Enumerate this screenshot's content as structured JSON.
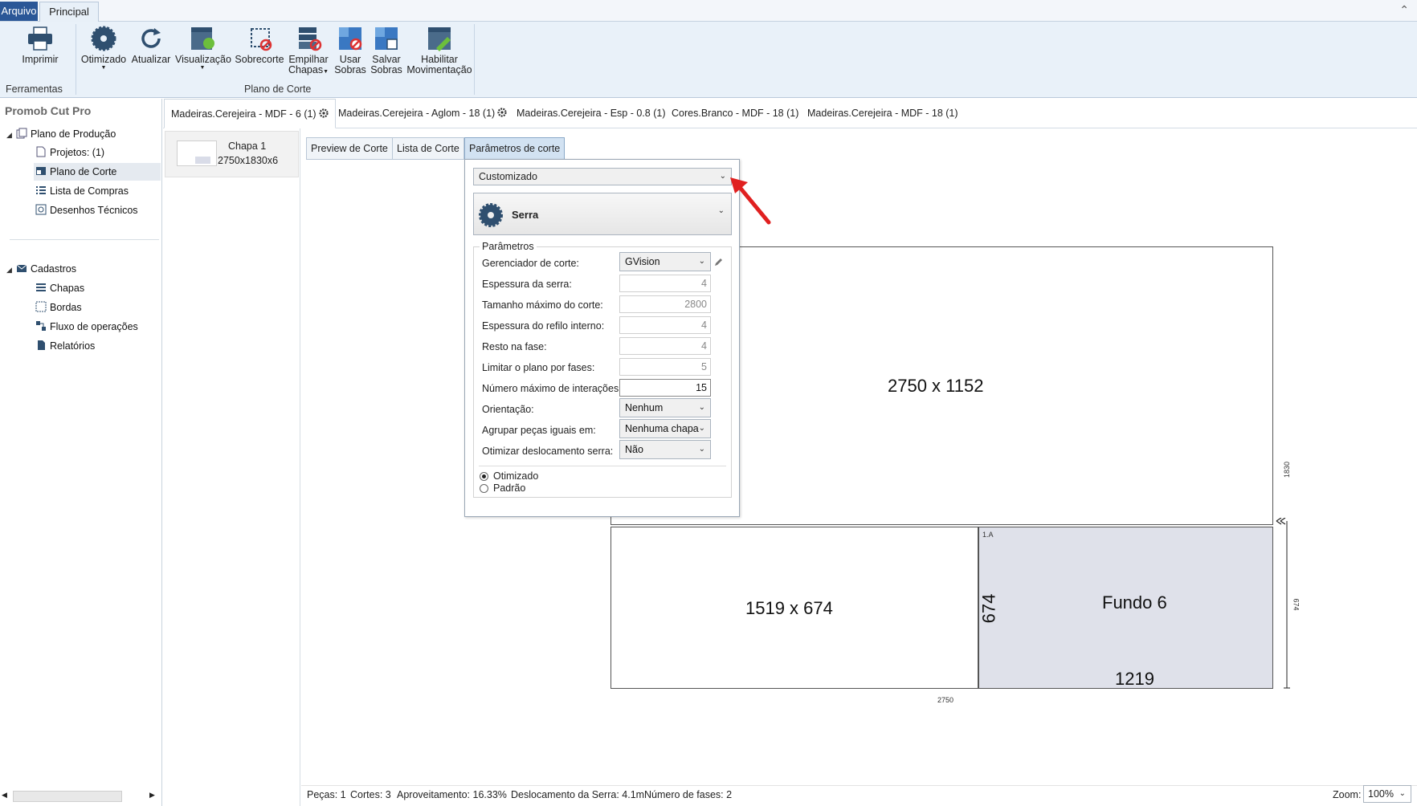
{
  "ribbon_tabs": {
    "file": "Arquivo",
    "home": "Principal"
  },
  "ribbon": {
    "print": "Imprimir",
    "optimized": "Otimizado",
    "refresh": "Atualizar",
    "view": "Visualização",
    "overcut": "Sobrecorte",
    "stack_l1": "Empilhar",
    "stack_l2": "Chapas",
    "use_leftovers_l1": "Usar",
    "use_leftovers_l2": "Sobras",
    "save_leftovers_l1": "Salvar",
    "save_leftovers_l2": "Sobras",
    "enable_l1": "Habilitar",
    "enable_l2": "Movimentação",
    "group_tools": "Ferramentas",
    "group_plan": "Plano de Corte"
  },
  "sidebar": {
    "title": "Promob Cut Pro",
    "production_plan": "Plano de Produção",
    "projects": "Projetos: (1)",
    "cut_plan": "Plano de Corte",
    "shopping_list": "Lista de Compras",
    "technical_drawings": "Desenhos Técnicos",
    "registers": "Cadastros",
    "sheets": "Chapas",
    "edges": "Bordas",
    "operations_flow": "Fluxo de operações",
    "reports": "Relatórios"
  },
  "material_tabs": [
    "Madeiras.Cerejeira - MDF - 6 (1)",
    "Madeiras.Cerejeira - Aglom - 18 (1)",
    "Madeiras.Cerejeira - Esp - 0.8 (1)",
    "Cores.Branco - MDF - 18 (1)",
    "Madeiras.Cerejeira - MDF - 18 (1)"
  ],
  "chapa": {
    "name": "Chapa 1",
    "size": "2750x1830x6"
  },
  "view_buttons": {
    "preview": "Preview de Corte",
    "list": "Lista de Corte",
    "params": "Parâmetros de corte"
  },
  "drawing": {
    "top_area": "2750 x 1152",
    "bottom_left": "1519 x 674",
    "piece_name": "Fundo 6",
    "piece_id": "1.A",
    "piece_height": "674",
    "piece_width": "1219",
    "dim_total_h": "1830",
    "dim_piece_h": "674",
    "dim_total_w": "2750"
  },
  "params": {
    "preset": "Customizado",
    "tool": "Serra",
    "legend": "Parâmetros",
    "fields": [
      {
        "label": "Gerenciador de corte:",
        "value": "GVision"
      },
      {
        "label": "Espessura da serra:",
        "value": "4"
      },
      {
        "label": "Tamanho máximo do corte:",
        "value": "2800"
      },
      {
        "label": "Espessura do refilo interno:",
        "value": "4"
      },
      {
        "label": "Resto na fase:",
        "value": "4"
      },
      {
        "label": "Limitar o plano por fases:",
        "value": "5"
      },
      {
        "label": "Número máximo de interações:",
        "value": "15"
      },
      {
        "label": "Orientação:",
        "value": "Nenhum"
      },
      {
        "label": "Agrupar peças iguais em:",
        "value": "Nenhuma chapa"
      },
      {
        "label": "Otimizar deslocamento serra:",
        "value": "Não"
      }
    ],
    "mode_optimized": "Otimizado",
    "mode_default": "Padrão"
  },
  "status": {
    "pieces": "Peças: 1",
    "cuts": "Cortes: 3",
    "usage": "Aproveitamento: 16.33%",
    "saw_travel": "Deslocamento da Serra: 4.1m",
    "phases": "Número de fases: 2",
    "zoom_label": "Zoom:",
    "zoom_value": "100%"
  },
  "colors": {
    "accent": "#2b5797",
    "piece_fill": "#dfe1ea",
    "annotation_arrow": "#e02020"
  }
}
